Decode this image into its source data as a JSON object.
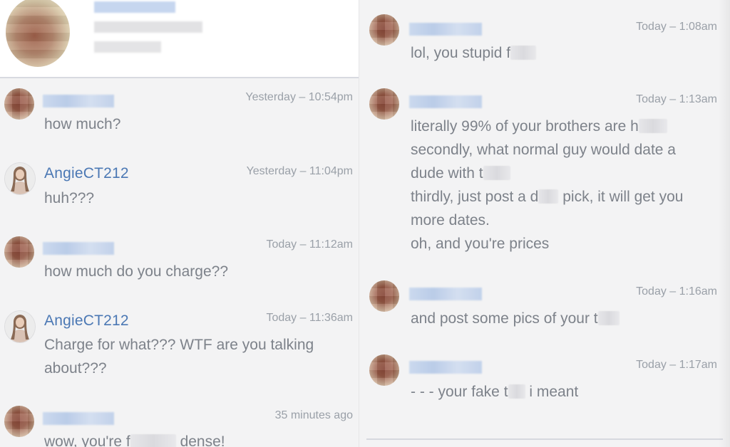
{
  "left": {
    "messages": [
      {
        "who": "redacted",
        "time": "Yesterday – 10:54pm",
        "lines": [
          [
            "how much?"
          ]
        ]
      },
      {
        "who": "AngieCT212",
        "time": "Yesterday – 11:04pm",
        "lines": [
          [
            "huh???"
          ]
        ]
      },
      {
        "who": "redacted",
        "time": "Today – 11:12am",
        "lines": [
          [
            "how much do you charge??"
          ]
        ]
      },
      {
        "who": "AngieCT212",
        "time": "Today – 11:36am",
        "lines": [
          [
            "Charge for what??? WTF are you talking"
          ],
          [
            "about???"
          ]
        ]
      },
      {
        "who": "redacted",
        "time": "35 minutes ago",
        "lines": [
          [
            "wow, you're f",
            "dense!"
          ]
        ]
      }
    ]
  },
  "right": {
    "messages": [
      {
        "who": "redacted",
        "time": "Today – 1:08am",
        "lines": [
          [
            "lol, you stupid f"
          ]
        ]
      },
      {
        "who": "redacted",
        "time": "Today – 1:13am",
        "lines": [
          [
            "literally 99% of your brothers are h"
          ],
          [
            "secondly, what normal guy would date a"
          ],
          [
            "dude with t"
          ],
          [
            "thirdly, just post a d",
            "pick, it will get you"
          ],
          [
            "more dates."
          ],
          [
            "oh, and you're prices"
          ]
        ]
      },
      {
        "who": "redacted",
        "time": "Today – 1:16am",
        "lines": [
          [
            "and post some pics of your t"
          ]
        ]
      },
      {
        "who": "redacted",
        "time": "Today – 1:17am",
        "lines": [
          [
            "- - - your fake t",
            "i meant"
          ]
        ]
      }
    ]
  },
  "angie_name": "AngieCT212",
  "colors": {
    "name": "#4b78b4",
    "text": "#7d828a",
    "time": "#9aa0a8",
    "bg": "#f3f3f4"
  }
}
